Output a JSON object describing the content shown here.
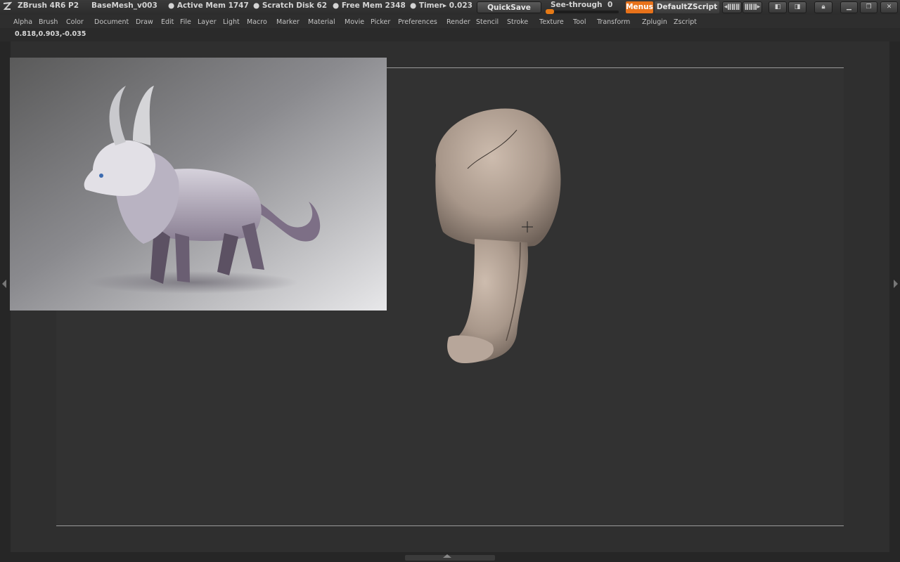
{
  "titlebar": {
    "app_name": "ZBrush 4R6 P2",
    "document": "BaseMesh_v003",
    "active_mem": "● Active Mem 1747",
    "scratch_disk": "● Scratch Disk 62",
    "free_mem": "● Free Mem 2348",
    "timer": "● Timer▸ 0.023",
    "quicksave": "QuickSave",
    "see_through_label": "See-through",
    "see_through_value": "0",
    "see_through_level": 0,
    "menus_button": "Menus",
    "default_zscript": "DefaultZScript",
    "accent_color": "#e8721a"
  },
  "menubar": {
    "items": [
      "Alpha",
      "Brush",
      "Color",
      "Document",
      "Draw",
      "Edit",
      "File",
      "Layer",
      "Light",
      "Macro",
      "Marker",
      "Material",
      "Movie",
      "Picker",
      "Preferences",
      "Render",
      "Stencil",
      "Stroke",
      "Texture",
      "Tool",
      "Transform",
      "Zplugin",
      "Zscript"
    ]
  },
  "coords": "0.818,0.903,-0.035",
  "icons": {
    "zbrush_logo": "zbrush-logo-icon",
    "scroll_left": "scroll-left-icon",
    "scroll_right": "scroll-right-icon",
    "layout_a": "layout-icon",
    "layout_b": "layout-icon",
    "lock": "lock-icon",
    "minimize": "minimize-icon",
    "restore": "restore-icon",
    "close": "close-icon"
  }
}
